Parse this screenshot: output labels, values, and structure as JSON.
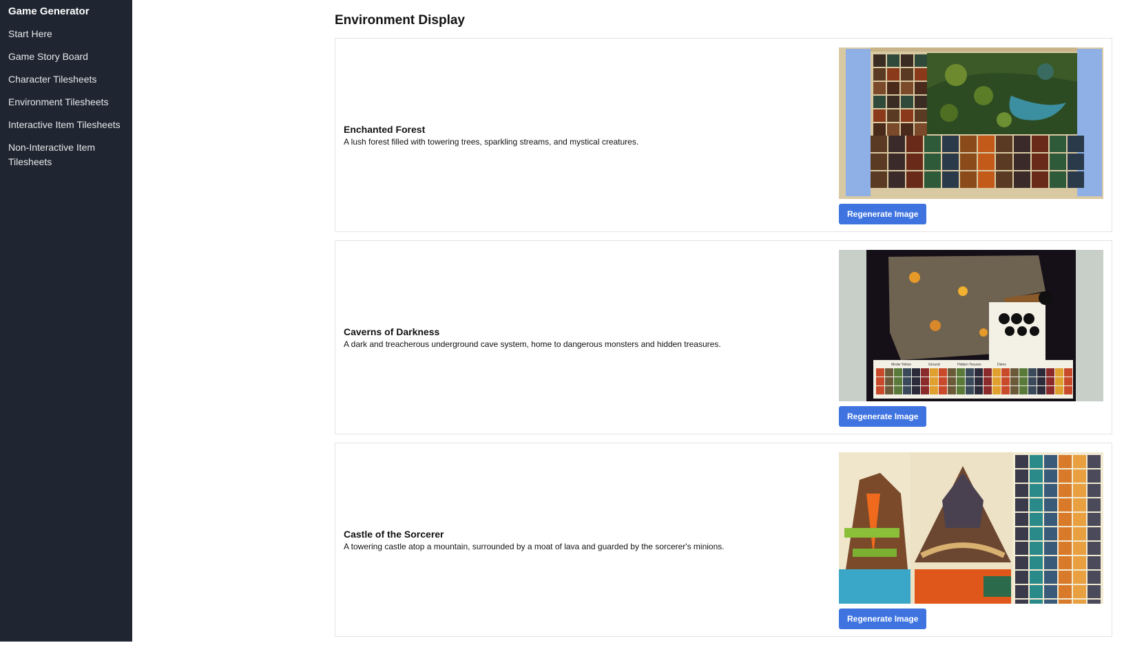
{
  "sidebar": {
    "app_title": "Game Generator",
    "items": [
      {
        "label": "Start Here"
      },
      {
        "label": "Game Story Board"
      },
      {
        "label": "Character Tilesheets"
      },
      {
        "label": "Environment Tilesheets"
      },
      {
        "label": "Interactive Item Tilesheets"
      },
      {
        "label": "Non-Interactive Item Tilesheets"
      }
    ]
  },
  "main": {
    "title": "Environment Display",
    "environments": [
      {
        "name": "Enchanted Forest",
        "description": "A lush forest filled with towering trees, sparkling streams, and mystical creatures.",
        "button_label": "Regenerate Image"
      },
      {
        "name": "Caverns of Darkness",
        "description": "A dark and treacherous underground cave system, home to dangerous monsters and hidden treasures.",
        "button_label": "Regenerate Image",
        "image_labels": [
          "Mndw Yellow",
          "Ground",
          "Hidden Tesures",
          "Dlens"
        ]
      },
      {
        "name": "Castle of the Sorcerer",
        "description": "A towering castle atop a mountain, surrounded by a moat of lava and guarded by the sorcerer's minions.",
        "button_label": "Regenerate Image"
      }
    ]
  },
  "colors": {
    "sidebar_bg": "#1f2631",
    "button_bg": "#3f74e0",
    "card_border": "#e3e3e3"
  }
}
